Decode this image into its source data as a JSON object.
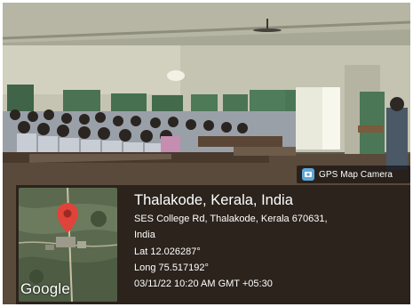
{
  "badge": {
    "icon": "gps-map-camera-icon",
    "label": "GPS Map Camera"
  },
  "map": {
    "logo_text": "Google",
    "pin_icon": "map-pin-icon"
  },
  "location": {
    "title": "Thalakode, Kerala, India",
    "address_line1": "SES College Rd, Thalakode, Kerala 670631,",
    "address_line2": "India",
    "lat": "Lat 12.026287°",
    "long": "Long 75.517192°",
    "datetime": "03/11/22 10:20 AM GMT +05:30"
  },
  "colors": {
    "pin": "#e0433a",
    "overlay": "#1a1812",
    "text": "#ffffff"
  }
}
